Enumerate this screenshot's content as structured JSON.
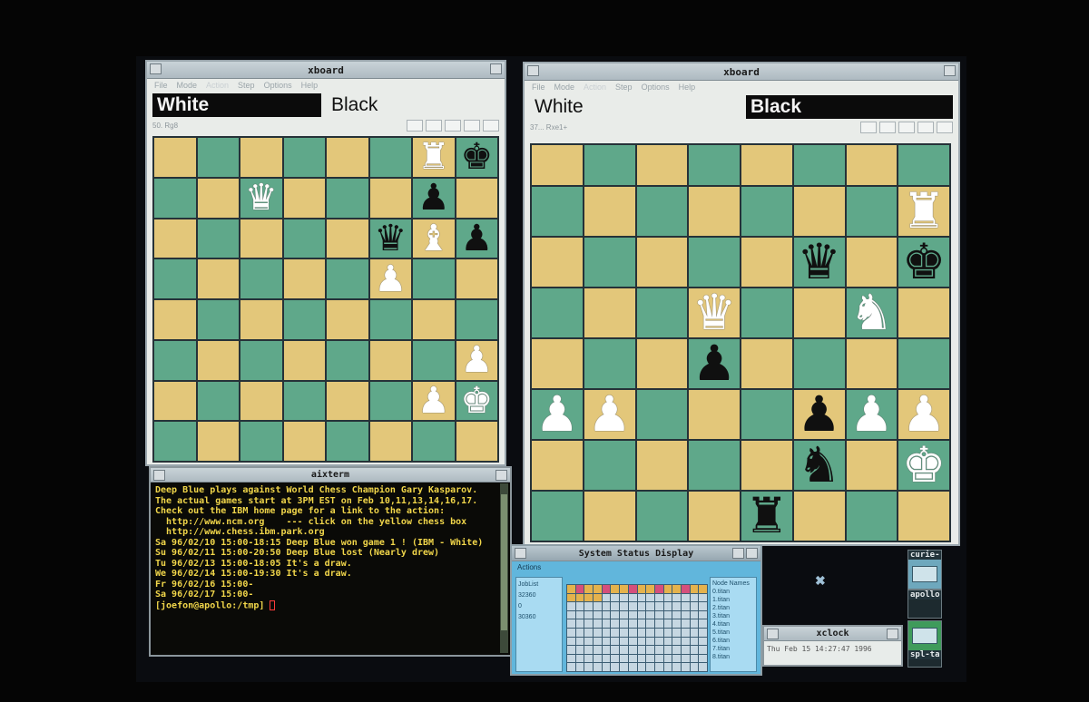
{
  "left_board_window": {
    "title": "xboard",
    "menu": [
      "File",
      "Mode",
      "Action",
      "Step",
      "Options",
      "Help"
    ],
    "white_clock": "White",
    "black_clock": "Black",
    "active_clock": "white",
    "message": "50. Rg8"
  },
  "right_board_window": {
    "title": "xboard",
    "menu": [
      "File",
      "Mode",
      "Action",
      "Step",
      "Options",
      "Help"
    ],
    "white_clock": "White",
    "black_clock": "Black",
    "active_clock": "black",
    "message": "37... Rxe1+"
  },
  "left_position": [
    [
      "",
      "",
      "",
      "",
      "",
      "",
      "wR",
      "bK"
    ],
    [
      "",
      "",
      "wQ",
      "",
      "",
      "",
      "bP",
      ""
    ],
    [
      "",
      "",
      "",
      "",
      "",
      "bQ",
      "wB",
      "bP"
    ],
    [
      "",
      "",
      "",
      "",
      "",
      "wP",
      "",
      ""
    ],
    [
      "",
      "",
      "",
      "",
      "",
      "",
      "",
      ""
    ],
    [
      "",
      "",
      "",
      "",
      "",
      "",
      "",
      "wP"
    ],
    [
      "",
      "",
      "",
      "",
      "",
      "",
      "wP",
      "wK"
    ],
    [
      "",
      "",
      "",
      "",
      "",
      "",
      "",
      ""
    ]
  ],
  "right_position": [
    [
      "",
      "",
      "",
      "",
      "",
      "",
      "",
      ""
    ],
    [
      "",
      "",
      "",
      "",
      "",
      "",
      "",
      "wR"
    ],
    [
      "",
      "",
      "",
      "",
      "",
      "bQ",
      "",
      "bK"
    ],
    [
      "",
      "",
      "",
      "wQ",
      "",
      "",
      "wN",
      ""
    ],
    [
      "",
      "",
      "",
      "bP",
      "",
      "",
      "",
      ""
    ],
    [
      "wP",
      "wP",
      "",
      "",
      "",
      "bP",
      "wP",
      "wP"
    ],
    [
      "",
      "",
      "",
      "",
      "",
      "bN",
      "",
      "wK"
    ],
    [
      "",
      "",
      "",
      "",
      "bR",
      "",
      "",
      ""
    ]
  ],
  "terminal": {
    "title": "aixterm",
    "lines": [
      "Deep Blue plays against World Chess Champion Gary Kasparov.",
      "The actual games start at 3PM EST on Feb 10,11,13,14,16,17.",
      "Check out the IBM home page for a link to the action:",
      "  http://www.ncm.org    --- click on the yellow chess box",
      "  http://www.chess.ibm.park.org",
      "",
      "Sa 96/02/10 15:00-18:15 Deep Blue won game 1 ! (IBM - White)",
      "",
      "Su 96/02/11 15:00-20:50 Deep Blue lost (Nearly drew)",
      "Tu 96/02/13 15:00-18:05 It's a draw.",
      "We 96/02/14 15:00-19:30 It's a draw.",
      "Fr 96/02/16 15:00-",
      "Sa 96/02/17 15:00-"
    ],
    "prompt": "[joefon@apollo:/tmp] "
  },
  "status_window": {
    "title": "System Status Display",
    "actions_label": "Actions",
    "joblist_header": "JobList",
    "joblist": [
      "32360",
      "0",
      "30360"
    ],
    "nodenames_header": "Node Names",
    "nodenames": [
      "0.titan",
      "1.titan",
      "2.titan",
      "3.titan",
      "4.titan",
      "5.titan",
      "6.titan",
      "7.titan",
      "8.titan"
    ]
  },
  "xclock": {
    "title": "xclock",
    "time": "Thu Feb 15 14:27:47 1996"
  },
  "icons": [
    {
      "label": "curie-",
      "icon": "terminal-icon"
    },
    {
      "label": "apollo",
      "icon": "terminal-icon"
    },
    {
      "label": "spl-ta",
      "icon": "terminal-icon"
    }
  ],
  "colors": {
    "light_square": "#e3c77a",
    "dark_square": "#5fa88a",
    "terminal_text": "#f1d64a"
  }
}
